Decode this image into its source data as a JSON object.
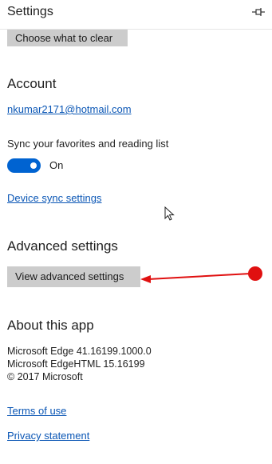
{
  "header": {
    "title": "Settings"
  },
  "clear": {
    "button_label": "Choose what to clear"
  },
  "account": {
    "heading": "Account",
    "email": "nkumar2171@hotmail.com",
    "sync_label": "Sync your favorites and reading list",
    "toggle_state": "On",
    "device_sync_link": "Device sync settings"
  },
  "advanced": {
    "heading": "Advanced settings",
    "button_label": "View advanced settings"
  },
  "about": {
    "heading": "About this app",
    "lines": [
      "Microsoft Edge 41.16199.1000.0",
      "Microsoft EdgeHTML 15.16199",
      "© 2017 Microsoft"
    ],
    "terms_link": "Terms of use",
    "privacy_link": "Privacy statement"
  },
  "colors": {
    "accent": "#0063d1",
    "link": "#0a56b5",
    "annotation": "#e01010",
    "button_bg": "#cccccc"
  }
}
